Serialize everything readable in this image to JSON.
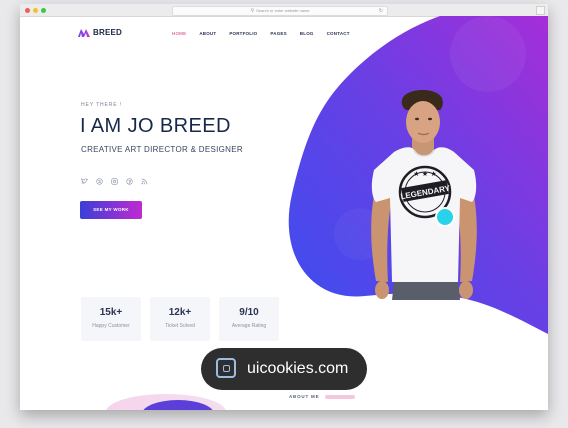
{
  "browser": {
    "url_placeholder": "Search or enter website name",
    "traffic_lights": [
      "#f15c55",
      "#f7be31",
      "#3ec744"
    ]
  },
  "brand": {
    "name": "BREED",
    "gradient": [
      "#5b4cf0",
      "#d233d6"
    ]
  },
  "nav": {
    "items": [
      "HOME",
      "ABOUT",
      "PORTFOLIO",
      "PAGES",
      "BLOG",
      "CONTACT"
    ],
    "active": "HOME"
  },
  "hero": {
    "greeting": "HEY THERE !",
    "title": "I AM JO BREED",
    "subtitle": "CREATIVE ART DIRECTOR & DESIGNER",
    "social_icons": [
      "twitter-icon",
      "skype-icon",
      "instagram-icon",
      "pinterest-icon",
      "rss-icon"
    ],
    "cta_label": "SEE MY WORK",
    "gradient": [
      "#3d52e4",
      "#b22fd6"
    ]
  },
  "stats": [
    {
      "value": "15k+",
      "label": "Happy Customer"
    },
    {
      "value": "12k+",
      "label": "Ticket Solved"
    },
    {
      "value": "9/10",
      "label": "Average Rating"
    }
  ],
  "tshirt_text": "LEGENDARY",
  "about_label": "ABOUT ME",
  "watermark": {
    "text": "uicookies.com"
  }
}
